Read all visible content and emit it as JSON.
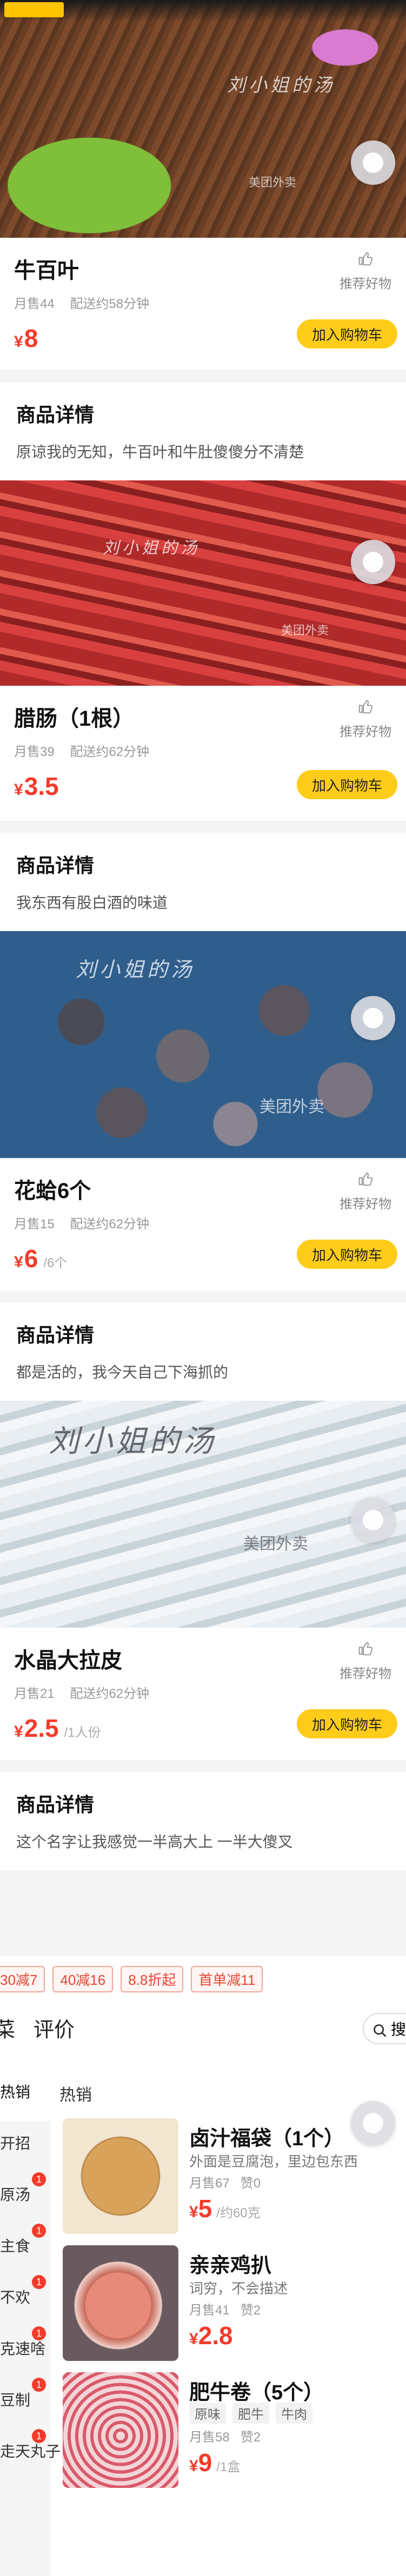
{
  "products": [
    {
      "name": "牛百叶",
      "monthly_sales": "月售44",
      "delivery": "配送约58分钟",
      "price": "8",
      "unit": "",
      "recommend": "推荐好物",
      "cart": "加入购物车",
      "detail_title": "商品详情",
      "detail_text": "原谅我的无知，牛百叶和牛肚傻傻分不清楚"
    },
    {
      "name": "腊肠（1根）",
      "monthly_sales": "月售39",
      "delivery": "配送约62分钟",
      "price": "3.5",
      "unit": "",
      "recommend": "推荐好物",
      "cart": "加入购物车",
      "detail_title": "商品详情",
      "detail_text": "我东西有股白酒的味道"
    },
    {
      "name": "花蛤6个",
      "monthly_sales": "月售15",
      "delivery": "配送约62分钟",
      "price": "6",
      "unit": "/6个",
      "recommend": "推荐好物",
      "cart": "加入购物车",
      "detail_title": "商品详情",
      "detail_text": "都是活的，我今天自己下海抓的"
    },
    {
      "name": "水晶大拉皮",
      "monthly_sales": "月售21",
      "delivery": "配送约62分钟",
      "price": "2.5",
      "unit": "/1人份",
      "recommend": "推荐好物",
      "cart": "加入购物车",
      "detail_title": "商品详情",
      "detail_text": "这个名字让我感觉一半高大上 一半大傻叉"
    }
  ],
  "watermarks": {
    "brand": "刘小姐的汤",
    "platform": "美团外卖"
  },
  "menu": {
    "promos": [
      "30减7",
      "40减16",
      "8.8折起",
      "首单减11"
    ],
    "tabs": [
      "菜",
      "评价"
    ],
    "search_label": "搜",
    "section_title": "热销",
    "sidebar": [
      {
        "label": "热销",
        "badge": ""
      },
      {
        "label": "开招",
        "badge": ""
      },
      {
        "label": "原汤",
        "badge": "1"
      },
      {
        "label": "主食",
        "badge": "1"
      },
      {
        "label": "不欢",
        "badge": "1"
      },
      {
        "label": "克速啥",
        "badge": "1"
      },
      {
        "label": "豆制",
        "badge": "1"
      },
      {
        "label": "走天丸子",
        "badge": "1"
      }
    ],
    "items": [
      {
        "name": "卤汁福袋（1个）",
        "desc": "外面是豆腐泡，里边包东西",
        "sales": "月售67",
        "likes": "赞0",
        "price": "5",
        "unit": "/约60克",
        "tags": []
      },
      {
        "name": "亲亲鸡扒",
        "desc": "词穷，不会描述",
        "sales": "月售41",
        "likes": "赞2",
        "price": "2.8",
        "unit": "",
        "tags": []
      },
      {
        "name": "肥牛卷（5个）",
        "desc": "",
        "sales": "月售58",
        "likes": "赞2",
        "price": "9",
        "unit": "/1盒",
        "tags": [
          "原味",
          "肥牛",
          "牛肉"
        ]
      }
    ]
  },
  "colors": {
    "price": "#f33b2b",
    "cart_button": "#ffcc1a",
    "promo_border": "#f3a49a"
  },
  "icons": {
    "recommend": "thumb-up-icon",
    "search": "search-icon",
    "float": "assistive-touch-icon"
  }
}
